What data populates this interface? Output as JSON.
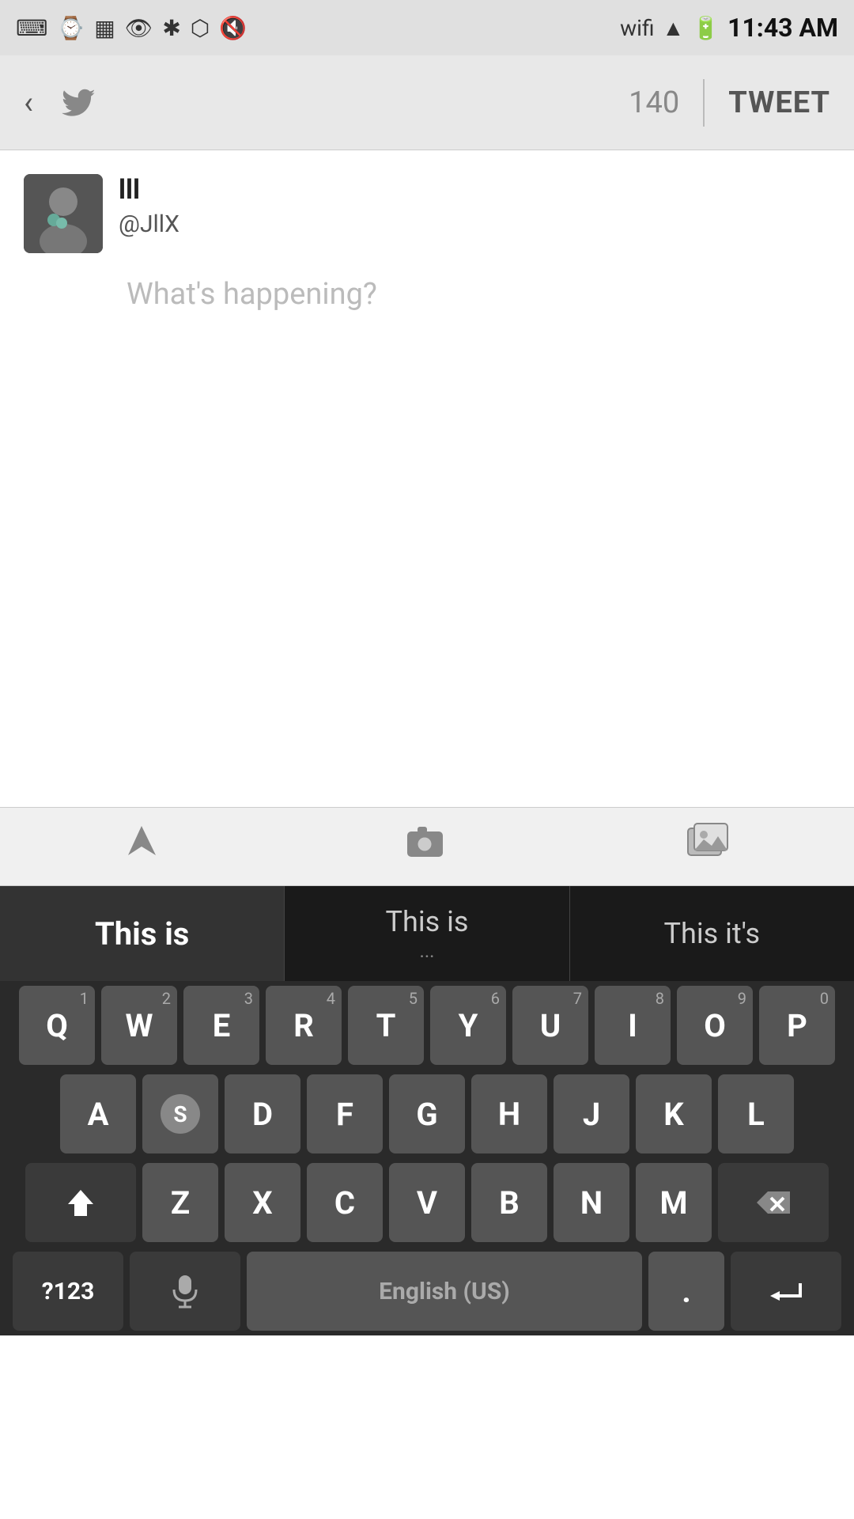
{
  "statusBar": {
    "time": "11:43 AM",
    "icons": [
      "keyboard-icon",
      "watch-icon",
      "grid-icon",
      "eye-icon",
      "bluetooth-icon",
      "nfc-icon",
      "mute-icon",
      "wifi-icon",
      "signal-icon",
      "battery-icon"
    ]
  },
  "appBar": {
    "backLabel": "‹",
    "logoAlt": "Twitter bird",
    "counter": "140",
    "tweetButton": "TWEET"
  },
  "compose": {
    "userName": "lll",
    "userHandle": "@JllX",
    "placeholder": "What's happening?"
  },
  "toolbar": {
    "locationIcon": "▶",
    "cameraIcon": "📷",
    "galleryIcon": "🖼"
  },
  "suggestions": {
    "item1": "This is",
    "item2": "This is",
    "item2dots": "...",
    "item3": "This it's"
  },
  "keyboard": {
    "row1": [
      {
        "label": "Q",
        "num": "1"
      },
      {
        "label": "W",
        "num": "2"
      },
      {
        "label": "E",
        "num": "3"
      },
      {
        "label": "R",
        "num": "4"
      },
      {
        "label": "T",
        "num": "5"
      },
      {
        "label": "Y",
        "num": "6"
      },
      {
        "label": "U",
        "num": "7"
      },
      {
        "label": "I",
        "num": "8"
      },
      {
        "label": "O",
        "num": "9"
      },
      {
        "label": "P",
        "num": "0"
      }
    ],
    "row2": [
      {
        "label": "A"
      },
      {
        "label": "S",
        "swipe": true
      },
      {
        "label": "D"
      },
      {
        "label": "F"
      },
      {
        "label": "G"
      },
      {
        "label": "H"
      },
      {
        "label": "J"
      },
      {
        "label": "K"
      },
      {
        "label": "L"
      }
    ],
    "row3": [
      {
        "label": "Z"
      },
      {
        "label": "X"
      },
      {
        "label": "C"
      },
      {
        "label": "V"
      },
      {
        "label": "B"
      },
      {
        "label": "N"
      },
      {
        "label": "M"
      }
    ],
    "row4": {
      "sym": "?123",
      "mic": "🎤",
      "space": "English (US)",
      "dot": ".",
      "enter": "↵"
    }
  }
}
